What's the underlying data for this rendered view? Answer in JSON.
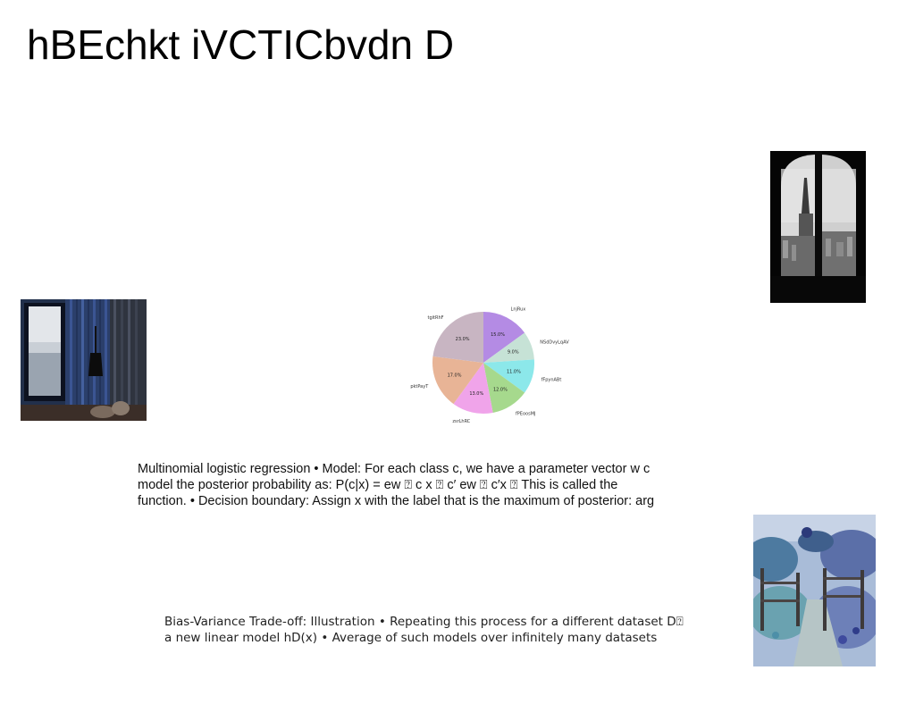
{
  "title": "hBEchkt iVCTICbvdn D",
  "images": {
    "window": "window-cityscape-photo",
    "room": "interior-room-photo",
    "garden": "garden-gate-photo"
  },
  "chart_data": {
    "type": "pie",
    "title": "",
    "slices": [
      {
        "label": "LnjRux",
        "value": 15.0,
        "pct_label": "15.0%",
        "color": "#b48be4"
      },
      {
        "label": "NSdDvyLqAV",
        "value": 9.0,
        "pct_label": "9.0%",
        "color": "#c6e2d6"
      },
      {
        "label": "fFpynABt",
        "value": 11.0,
        "pct_label": "11.0%",
        "color": "#8ce8ea"
      },
      {
        "label": "fPEoosMJ",
        "value": 12.0,
        "pct_label": "12.0%",
        "color": "#a6d98d"
      },
      {
        "label": "zsrLhRC",
        "value": 13.0,
        "pct_label": "13.0%",
        "color": "#f0a4ea"
      },
      {
        "label": "pktPayT",
        "value": 17.0,
        "pct_label": "17.0%",
        "color": "#e8b496"
      },
      {
        "label": "tgitRhF",
        "value": 23.0,
        "pct_label": "23.0%",
        "color": "#c8b5c2"
      }
    ],
    "start_angle_deg": 90,
    "direction": "clockwise"
  },
  "text_logistic": {
    "line1": "Multinomial logistic regression • Model: For each class c, we have a parameter vector w c",
    "line2": "model the posterior probability as: P(c|x) = ew ⍰ c x ⍰ c′ ew ⍰ c′x ⍰ This is called the",
    "line3": "function. • Decision boundary: Assign x with the label that is the maximum of posterior: arg"
  },
  "text_bias": {
    "line1": "Bias-Variance Trade-off: Illustration • Repeating this process for a different dataset D⍰",
    "line2": "a new linear model hD(x) • Average of such models over infinitely many datasets"
  }
}
